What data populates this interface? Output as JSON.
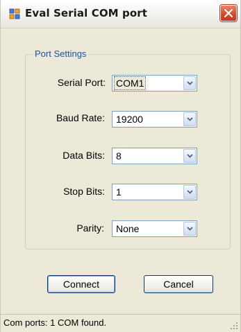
{
  "window": {
    "title": "Eval Serial COM port",
    "app_icon": "window-app-icon",
    "close_icon": "close-icon"
  },
  "port_settings": {
    "legend": "Port Settings",
    "fields": [
      {
        "label": "Serial Port:",
        "value": "COM1"
      },
      {
        "label": "Baud Rate:",
        "value": "19200"
      },
      {
        "label": "Data Bits:",
        "value": "8"
      },
      {
        "label": "Stop Bits:",
        "value": "1"
      },
      {
        "label": "Parity:",
        "value": "None"
      }
    ],
    "dropdown_icon": "chevron-down-icon"
  },
  "buttons": {
    "connect": "Connect",
    "cancel": "Cancel"
  },
  "status": {
    "text": "Com ports: 1 COM found."
  },
  "colors": {
    "legend": "#1e4fb3",
    "close": "#d4482a",
    "background": "#ece9d8"
  }
}
